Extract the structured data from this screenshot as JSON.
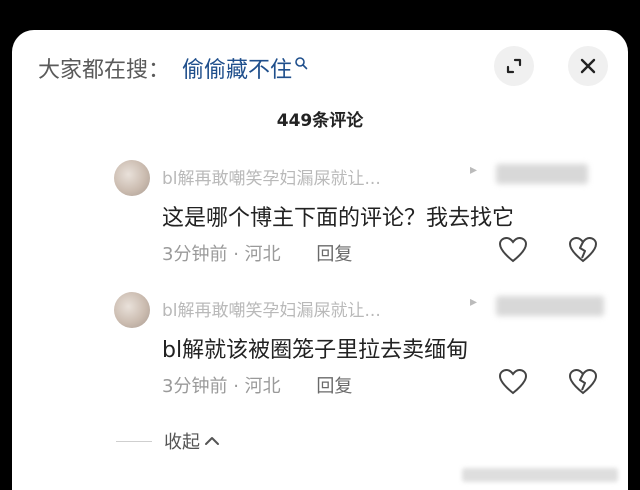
{
  "search": {
    "prefix": "大家都在搜：",
    "term": "偷偷藏不住"
  },
  "comments_count": "449条评论",
  "comments": [
    {
      "username": "bl解再敢嘲笑孕妇漏屎就让...",
      "text": "这是哪个博主下面的评论？我去找它",
      "time": "3分钟前",
      "location": "河北",
      "reply": "回复"
    },
    {
      "username": "bl解再敢嘲笑孕妇漏屎就让...",
      "text": "bl解就该被圈笼子里拉去卖缅甸",
      "time": "3分钟前",
      "location": "河北",
      "reply": "回复"
    }
  ],
  "collapse_label": "收起",
  "icons": {
    "search": "search-icon",
    "expand": "expand-icon",
    "close": "close-icon",
    "reply_arrow": "reply-arrow-icon",
    "like": "heart-icon",
    "dislike": "broken-heart-icon",
    "collapse": "chevron-up-icon"
  }
}
